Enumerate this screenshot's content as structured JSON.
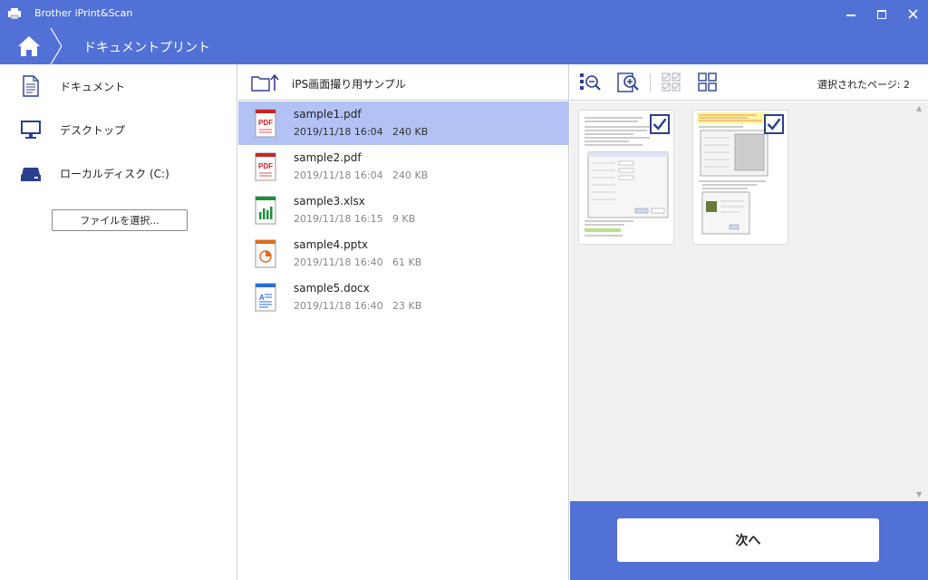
{
  "app": {
    "title": "Brother iPrint&Scan"
  },
  "window_controls": {
    "minimize": "—",
    "maximize": "☐",
    "close": "✕"
  },
  "nav": {
    "title": "ドキュメントプリント"
  },
  "sidebar": {
    "items": [
      {
        "label": "ドキュメント",
        "icon": "document-icon"
      },
      {
        "label": "デスクトップ",
        "icon": "monitor-icon"
      },
      {
        "label": "ローカルディスク (C:)",
        "icon": "drive-icon"
      }
    ],
    "choose_file": "ファイルを選択..."
  },
  "folder": {
    "name": "iPS画面撮り用サンプル"
  },
  "files": [
    {
      "name": "sample1.pdf",
      "date": "2019/11/18 16:04",
      "size": "240 KB",
      "type": "pdf",
      "selected": true
    },
    {
      "name": "sample2.pdf",
      "date": "2019/11/18 16:04",
      "size": "240 KB",
      "type": "pdf",
      "selected": false
    },
    {
      "name": "sample3.xlsx",
      "date": "2019/11/18 16:15",
      "size": "9 KB",
      "type": "xlsx",
      "selected": false
    },
    {
      "name": "sample4.pptx",
      "date": "2019/11/18 16:40",
      "size": "61 KB",
      "type": "pptx",
      "selected": false
    },
    {
      "name": "sample5.docx",
      "date": "2019/11/18 16:40",
      "size": "23 KB",
      "type": "docx",
      "selected": false
    }
  ],
  "file_icon_labels": {
    "pdf": "PDF"
  },
  "preview": {
    "selected_pages": "選択されたページ: 2",
    "pages": [
      {
        "checked": true
      },
      {
        "checked": true
      }
    ]
  },
  "next_button": "次へ",
  "colors": {
    "accent": "#5271d6",
    "selected_row": "#b3c2f5",
    "pdf": "#cc2222",
    "xlsx": "#1e8f3a",
    "pptx": "#e06a1b",
    "docx": "#2b6cd6"
  }
}
